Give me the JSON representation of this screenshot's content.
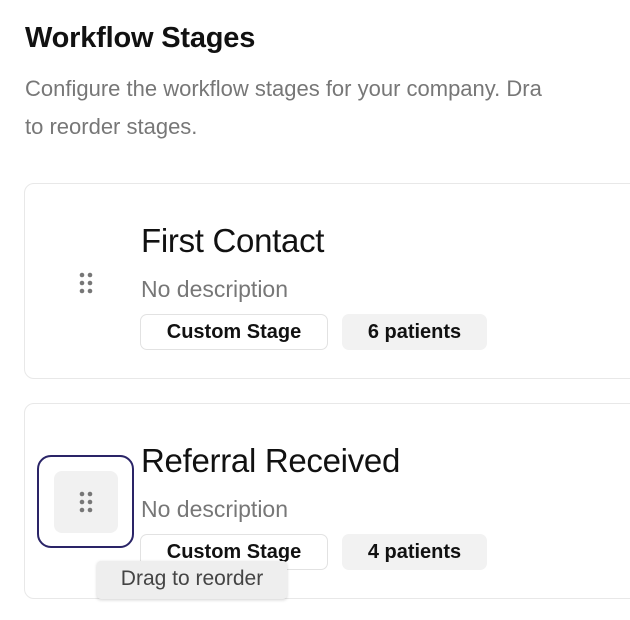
{
  "header": {
    "title": "Workflow Stages",
    "subtitle_line1": "Configure the workflow stages for your company. Dra",
    "subtitle_line2": "to reorder stages."
  },
  "stages": [
    {
      "name": "First Contact",
      "description": "No description",
      "type_badge": "Custom Stage",
      "count_badge": "6 patients",
      "drag_icon": "grip-vertical-icon"
    },
    {
      "name": "Referral Received",
      "description": "No description",
      "type_badge": "Custom Stage",
      "count_badge": "4 patients",
      "drag_icon": "grip-vertical-icon"
    }
  ],
  "tooltip": {
    "text": "Drag to reorder"
  },
  "colors": {
    "focus_ring": "#2a2467",
    "muted_text": "#777777",
    "card_border": "#e8e8e8",
    "count_badge_bg": "#f2f2f2"
  }
}
